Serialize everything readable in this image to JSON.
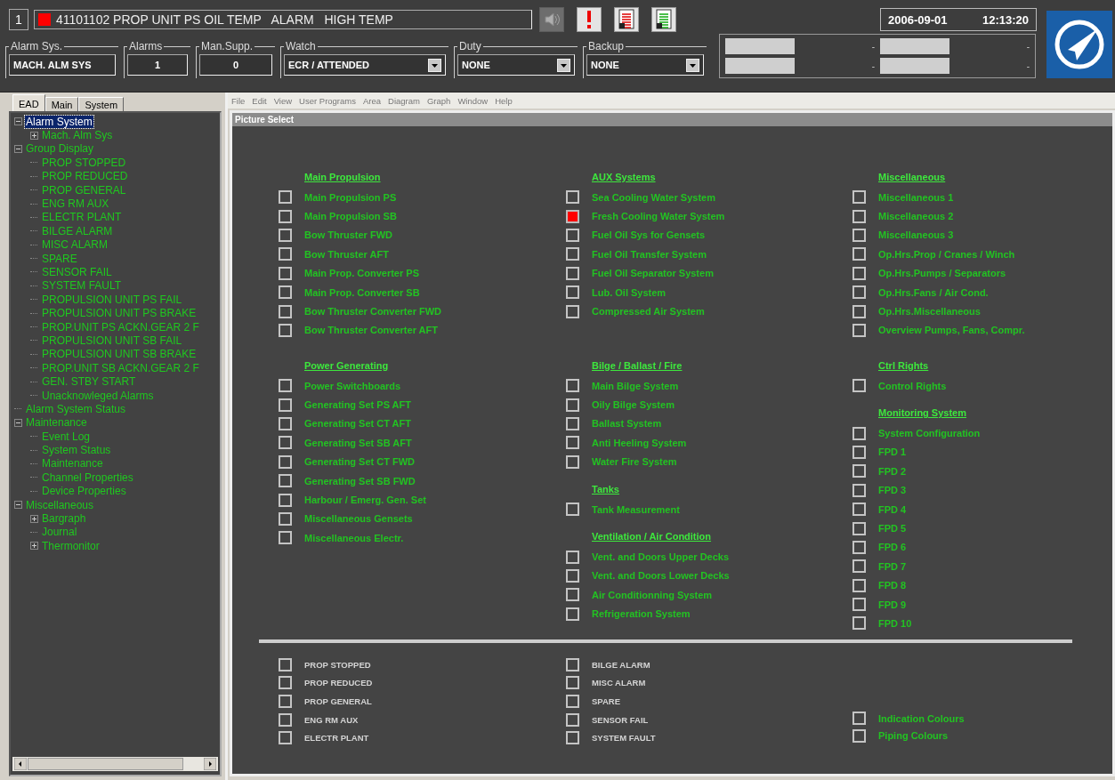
{
  "alarm_bar": {
    "count": "1",
    "message": "41101102 PROP UNIT PS OIL TEMP   ALARM   HIGH TEMP",
    "date": "2006-09-01",
    "time": "12:13:20",
    "tools": [
      {
        "kind": "speaker",
        "disabled": true
      },
      {
        "kind": "alert",
        "disabled": false
      },
      {
        "kind": "report-red",
        "disabled": false
      },
      {
        "kind": "report-green",
        "disabled": false
      }
    ]
  },
  "fields": [
    {
      "label": "Alarm Sys.",
      "value": "MACH. ALM SYS",
      "kind": "text"
    },
    {
      "label": "Alarms",
      "value": "1",
      "kind": "number"
    },
    {
      "label": "Man.Supp.",
      "value": "0",
      "kind": "number"
    },
    {
      "label": "Watch",
      "value": "ECR / ATTENDED",
      "kind": "dropdown"
    },
    {
      "label": "Duty",
      "value": "NONE",
      "kind": "dropdown"
    },
    {
      "label": "Backup",
      "value": "NONE",
      "kind": "dropdown"
    }
  ],
  "status_slots": [
    "-",
    "-",
    "-",
    "-"
  ],
  "tabs": [
    {
      "label": "EAD",
      "selected": true
    },
    {
      "label": "Main",
      "selected": false
    },
    {
      "label": "System",
      "selected": false
    }
  ],
  "tree": [
    {
      "label": "Alarm System",
      "expanded": true,
      "selected": true,
      "children": [
        {
          "label": "Mach. Alm Sys",
          "expanded": false,
          "selected": false
        }
      ]
    },
    {
      "label": "Group Display",
      "expanded": true,
      "selected": false,
      "children": [
        {
          "label": "PROP STOPPED",
          "selected": false
        },
        {
          "label": "PROP REDUCED",
          "selected": false
        },
        {
          "label": "PROP GENERAL",
          "selected": false
        },
        {
          "label": "ENG RM AUX",
          "selected": false
        },
        {
          "label": "ELECTR PLANT",
          "selected": false
        },
        {
          "label": "BILGE ALARM",
          "selected": false
        },
        {
          "label": "MISC ALARM",
          "selected": false
        },
        {
          "label": "SPARE",
          "selected": false
        },
        {
          "label": "SENSOR FAIL",
          "selected": false
        },
        {
          "label": "SYSTEM FAULT",
          "selected": false
        },
        {
          "label": "PROPULSION UNIT PS FAIL",
          "selected": false
        },
        {
          "label": "PROPULSION UNIT PS BRAKE",
          "selected": false
        },
        {
          "label": "PROP.UNIT PS ACKN.GEAR 2 F",
          "selected": false
        },
        {
          "label": "PROPULSION UNIT SB FAIL",
          "selected": false
        },
        {
          "label": "PROPULSION UNIT SB BRAKE",
          "selected": false
        },
        {
          "label": "PROP.UNIT SB ACKN.GEAR 2 F",
          "selected": false
        },
        {
          "label": "GEN. STBY START",
          "selected": false
        },
        {
          "label": "Unacknowleged Alarms",
          "selected": false
        }
      ]
    },
    {
      "label": "Alarm System Status",
      "selected": false
    },
    {
      "label": "Maintenance",
      "expanded": true,
      "selected": false,
      "children": [
        {
          "label": "Event Log",
          "selected": false
        },
        {
          "label": "System Status",
          "selected": false
        },
        {
          "label": "Maintenance",
          "selected": false
        },
        {
          "label": "Channel Properties",
          "selected": false
        },
        {
          "label": "Device Properties",
          "selected": false
        }
      ]
    },
    {
      "label": "Miscellaneous",
      "expanded": true,
      "selected": false,
      "children": [
        {
          "label": "Bargraph",
          "expanded": false,
          "selected": false
        },
        {
          "label": "Journal",
          "selected": false
        },
        {
          "label": "Thermonitor",
          "expanded": false,
          "selected": false
        }
      ]
    }
  ],
  "menu": [
    "File",
    "Edit",
    "View",
    "User Programs",
    "Area",
    "Diagram",
    "Graph",
    "Window",
    "Help"
  ],
  "picture_select": {
    "title": "Picture Select",
    "columns": [
      {
        "sections": [
          {
            "heading": "Main Propulsion",
            "items": [
              {
                "label": "Main Propulsion PS",
                "alarm": false
              },
              {
                "label": "Main Propulsion SB",
                "alarm": false
              },
              {
                "label": "Bow Thruster FWD",
                "alarm": false
              },
              {
                "label": "Bow Thruster AFT",
                "alarm": false
              },
              {
                "label": "Main Prop. Converter PS",
                "alarm": false
              },
              {
                "label": "Main Prop. Converter SB",
                "alarm": false
              },
              {
                "label": "Bow Thruster Converter FWD",
                "alarm": false
              },
              {
                "label": "Bow Thruster Converter AFT",
                "alarm": false
              }
            ]
          },
          {
            "heading": "Power Generating",
            "items": [
              {
                "label": "Power Switchboards",
                "alarm": false
              },
              {
                "label": "Generating Set PS AFT",
                "alarm": false
              },
              {
                "label": "Generating Set CT AFT",
                "alarm": false
              },
              {
                "label": "Generating Set SB AFT",
                "alarm": false
              },
              {
                "label": "Generating Set CT FWD",
                "alarm": false
              },
              {
                "label": "Generating Set SB FWD",
                "alarm": false
              },
              {
                "label": "Harbour / Emerg. Gen. Set",
                "alarm": false
              },
              {
                "label": "Miscellaneous Gensets",
                "alarm": false
              },
              {
                "label": "Miscellaneous Electr.",
                "alarm": false
              }
            ]
          }
        ]
      },
      {
        "sections": [
          {
            "heading": "AUX Systems",
            "items": [
              {
                "label": "Sea Cooling Water System",
                "alarm": false
              },
              {
                "label": "Fresh Cooling Water System",
                "alarm": true
              },
              {
                "label": "Fuel Oil Sys for Gensets",
                "alarm": false
              },
              {
                "label": "Fuel Oil Transfer System",
                "alarm": false
              },
              {
                "label": "Fuel Oil Separator System",
                "alarm": false
              },
              {
                "label": "Lub. Oil System",
                "alarm": false
              },
              {
                "label": "Compressed Air System",
                "alarm": false
              }
            ]
          },
          {
            "heading": "Bilge / Ballast / Fire",
            "items": [
              {
                "label": "Main Bilge System",
                "alarm": false
              },
              {
                "label": "Oily Bilge System",
                "alarm": false
              },
              {
                "label": "Ballast System",
                "alarm": false
              },
              {
                "label": "Anti Heeling System",
                "alarm": false
              },
              {
                "label": "Water Fire System",
                "alarm": false
              }
            ]
          },
          {
            "heading": "Tanks",
            "items": [
              {
                "label": "Tank Measurement",
                "alarm": false
              }
            ]
          },
          {
            "heading": "Ventilation / Air Condition",
            "items": [
              {
                "label": "Vent. and Doors Upper Decks",
                "alarm": false
              },
              {
                "label": "Vent. and Doors Lower Decks",
                "alarm": false
              },
              {
                "label": "Air Conditionning System",
                "alarm": false
              },
              {
                "label": "Refrigeration System",
                "alarm": false
              }
            ]
          }
        ]
      },
      {
        "sections": [
          {
            "heading": "Miscellaneous",
            "items": [
              {
                "label": "Miscellaneous 1",
                "alarm": false
              },
              {
                "label": "Miscellaneous 2",
                "alarm": false
              },
              {
                "label": "Miscellaneous 3",
                "alarm": false
              },
              {
                "label": "Op.Hrs.Prop / Cranes / Winch",
                "alarm": false
              },
              {
                "label": "Op.Hrs.Pumps / Separators",
                "alarm": false
              },
              {
                "label": "Op.Hrs.Fans / Air Cond.",
                "alarm": false
              },
              {
                "label": "Op.Hrs.Miscellaneous",
                "alarm": false
              },
              {
                "label": "Overview Pumps, Fans, Compr.",
                "alarm": false
              }
            ]
          },
          {
            "heading": "Ctrl Rights",
            "items": [
              {
                "label": "Control Rights",
                "alarm": false
              }
            ]
          },
          {
            "heading": "Monitoring System",
            "items": [
              {
                "label": "System Configuration",
                "alarm": false
              },
              {
                "label": "FPD 1",
                "alarm": false
              },
              {
                "label": "FPD 2",
                "alarm": false
              },
              {
                "label": "FPD 3",
                "alarm": false
              },
              {
                "label": "FPD 4",
                "alarm": false
              },
              {
                "label": "FPD 5",
                "alarm": false
              },
              {
                "label": "FPD 6",
                "alarm": false
              },
              {
                "label": "FPD 7",
                "alarm": false
              },
              {
                "label": "FPD 8",
                "alarm": false
              },
              {
                "label": "FPD 9",
                "alarm": false
              },
              {
                "label": "FPD 10",
                "alarm": false
              }
            ]
          }
        ]
      }
    ],
    "bottom_columns": [
      [
        {
          "label": "PROP STOPPED",
          "kind": "group",
          "alarm": false
        },
        {
          "label": "PROP REDUCED",
          "kind": "group",
          "alarm": false
        },
        {
          "label": "PROP GENERAL",
          "kind": "group",
          "alarm": false
        },
        {
          "label": "ENG RM AUX",
          "kind": "group",
          "alarm": false
        },
        {
          "label": "ELECTR PLANT",
          "kind": "group",
          "alarm": false
        }
      ],
      [
        {
          "label": "BILGE ALARM",
          "kind": "group",
          "alarm": false
        },
        {
          "label": "MISC ALARM",
          "kind": "group",
          "alarm": false
        },
        {
          "label": "SPARE",
          "kind": "group",
          "alarm": false
        },
        {
          "label": "SENSOR FAIL",
          "kind": "group",
          "alarm": false
        },
        {
          "label": "SYSTEM FAULT",
          "kind": "group",
          "alarm": false
        }
      ],
      [
        {
          "label": "Indication Colours",
          "kind": "picture",
          "alarm": false
        },
        {
          "label": "Piping Colours",
          "kind": "picture",
          "alarm": false
        }
      ]
    ]
  }
}
